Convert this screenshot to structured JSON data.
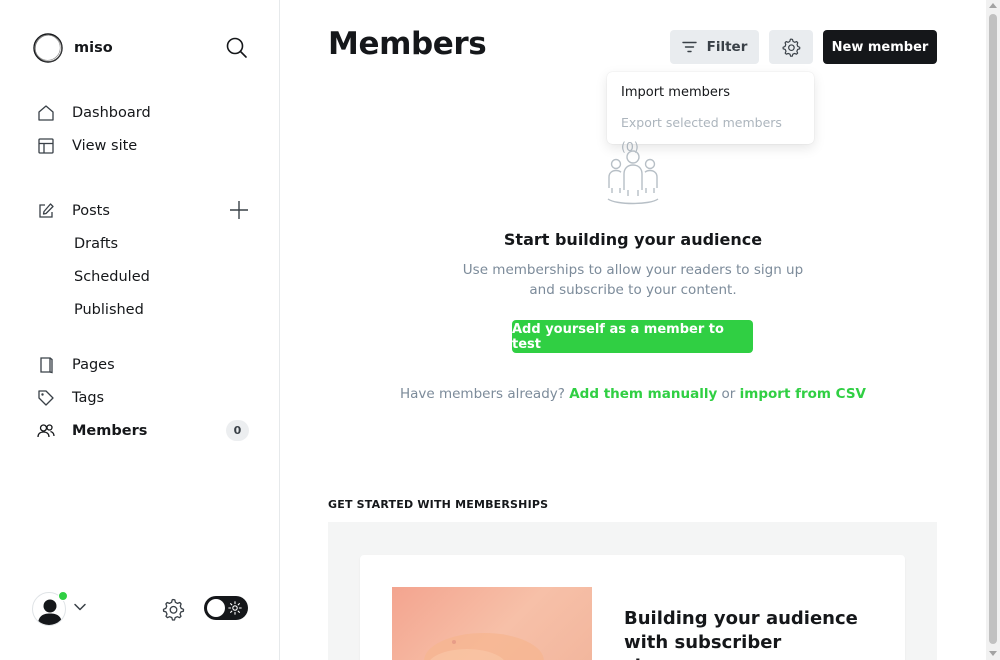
{
  "brand": {
    "name": "miso"
  },
  "sidebar": {
    "items": [
      {
        "label": "Dashboard",
        "icon": "home-icon"
      },
      {
        "label": "View site",
        "icon": "layout-icon"
      },
      {
        "label": "Posts",
        "icon": "edit-icon"
      },
      {
        "label": "Drafts"
      },
      {
        "label": "Scheduled"
      },
      {
        "label": "Published"
      },
      {
        "label": "Pages",
        "icon": "page-icon"
      },
      {
        "label": "Tags",
        "icon": "tag-icon"
      },
      {
        "label": "Members",
        "icon": "members-icon",
        "count": "0",
        "active": true
      }
    ]
  },
  "header": {
    "title": "Members",
    "filter_label": "Filter",
    "new_member_label": "New member"
  },
  "dropdown": {
    "import_label": "Import members",
    "export_label": "Export selected members (0)"
  },
  "empty_state": {
    "title": "Start building your audience",
    "description": "Use memberships to allow your readers to sign up and subscribe to your content.",
    "cta_label": "Add yourself as a member to test",
    "helper_prefix": "Have members already?",
    "helper_link1": "Add them manually",
    "helper_or": "or",
    "helper_link2": "import from CSV"
  },
  "get_started": {
    "heading": "GET STARTED WITH MEMBERSHIPS",
    "card_title": "Building your audience with subscriber signups"
  },
  "colors": {
    "accent": "#30cf43",
    "primary_button": "#15171a",
    "secondary_button": "#e9ecef",
    "muted_text": "#7c8b9a"
  }
}
